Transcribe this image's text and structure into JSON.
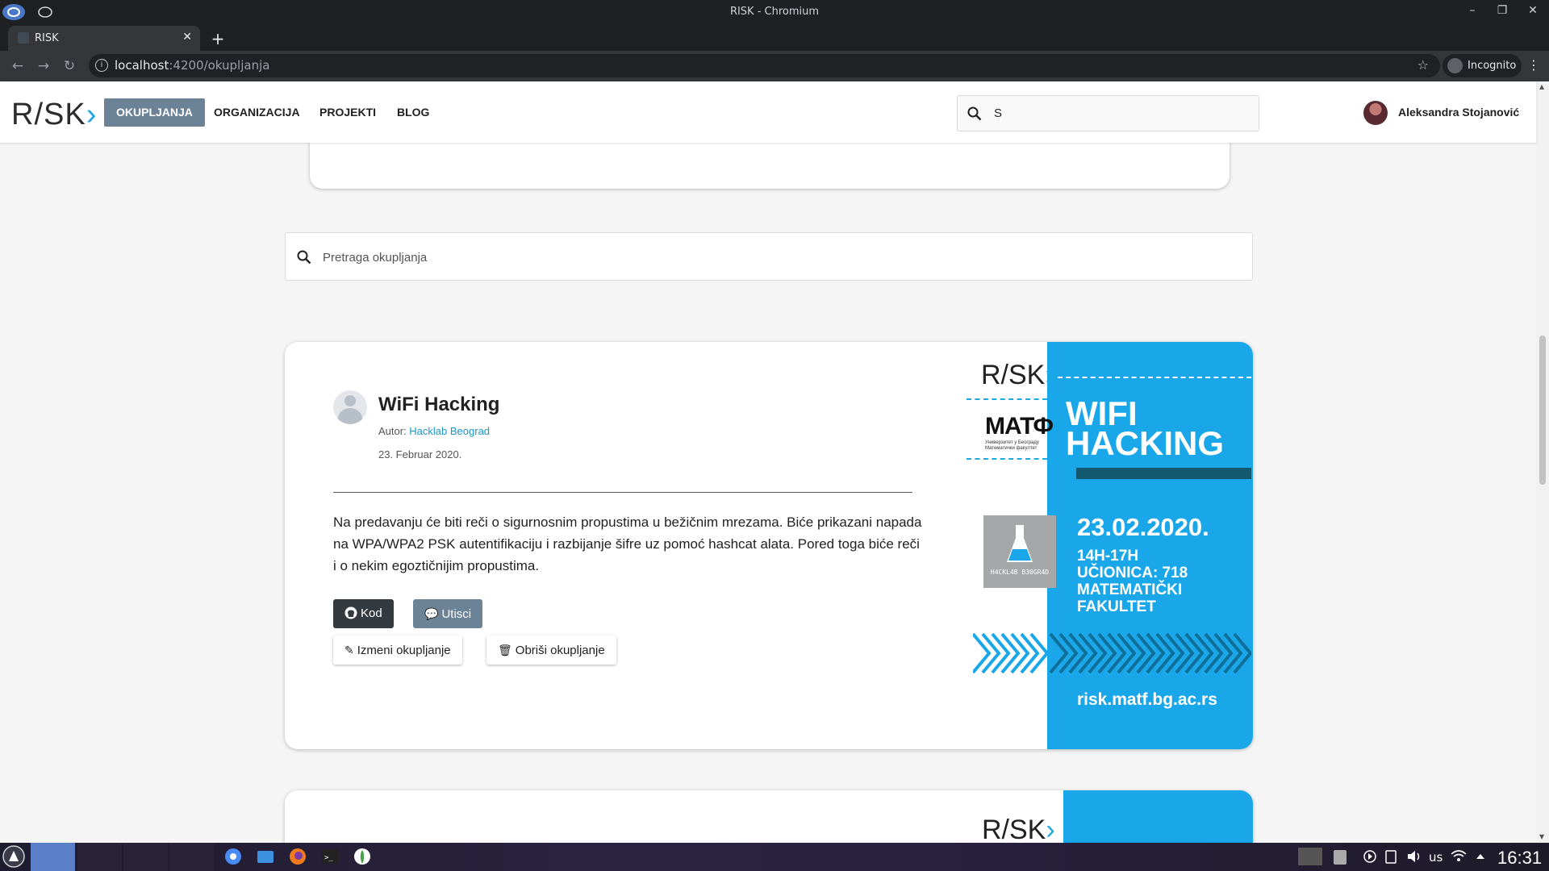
{
  "browser": {
    "window_title": "RISK - Chromium",
    "tab_title": "RISK",
    "url_host": "localhost",
    "url_path": ":4200/okupljanja",
    "profile_label": "Incognito"
  },
  "app": {
    "logo_text": "R/SK",
    "logo_chevron": "›",
    "nav": [
      {
        "label": "OKUPLJANJA",
        "active": true
      },
      {
        "label": "ORGANIZACIJA",
        "active": false
      },
      {
        "label": "PROJEKTI",
        "active": false
      },
      {
        "label": "BLOG",
        "active": false
      }
    ],
    "top_search_value": "S",
    "user_name": "Aleksandra Stojanović"
  },
  "events_search": {
    "placeholder": "Pretraga okupljanja"
  },
  "event": {
    "title": "WiFi Hacking",
    "author_prefix": "Autor: ",
    "author": "Hacklab Beograd",
    "date": "23. Februar 2020.",
    "description": "Na predavanju će biti reči o sigurnosnim propustima u bežičnim mrezama. Biće prikazani napada na WPA/WPA2 PSK autentifikaciju i razbijanje šifre uz pomoć hashcat alata. Pored toga biće reči i o nekim egoztičnijim propustima.",
    "buttons": {
      "code": "Kod",
      "feedback": "Utisci",
      "edit": "Izmeni okupljanje",
      "delete": "Obriši okupljanje"
    },
    "poster": {
      "logo": "R/SK",
      "matf": "МАТФ",
      "matf_sub": "Универзитет у Београду Математички факултет",
      "hacklab": "H4CKL4B B30GR4D",
      "headline_1": "WIFI",
      "headline_2": "HACKING",
      "date": "23.02.2020.",
      "time": "14H-17H",
      "room": "UČIONICA: 718",
      "place_1": "MATEMATIČKI",
      "place_2": "FAKULTET",
      "url": "risk.matf.bg.ac.rs"
    }
  },
  "next_card": {
    "logo": "R/SK"
  },
  "taskbar": {
    "lang": "us",
    "clock": "16:31"
  },
  "colors": {
    "accent_blue": "#1aa7ea",
    "nav_active": "#6c8397",
    "link": "#1b96c8"
  }
}
